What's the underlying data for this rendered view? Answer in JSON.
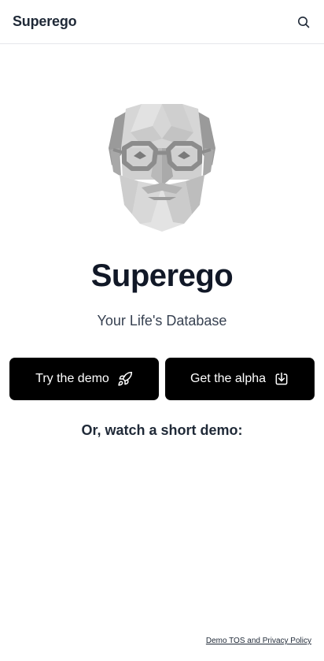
{
  "header": {
    "brand": "Superego",
    "search_icon": "search-icon"
  },
  "hero": {
    "image_icon": "freud-face-logo",
    "title": "Superego",
    "subtitle": "Your Life's Database"
  },
  "actions": {
    "demo_label": "Try the demo",
    "demo_icon": "rocket-icon",
    "alpha_label": "Get the alpha",
    "alpha_icon": "download-icon"
  },
  "video": {
    "intro": "Or, watch a short demo:"
  },
  "footer": {
    "link": "Demo TOS and Privacy Policy"
  },
  "colors": {
    "button_bg": "#000000",
    "button_text": "#ffffff",
    "text_primary": "#111827",
    "border": "#e5e7eb"
  }
}
